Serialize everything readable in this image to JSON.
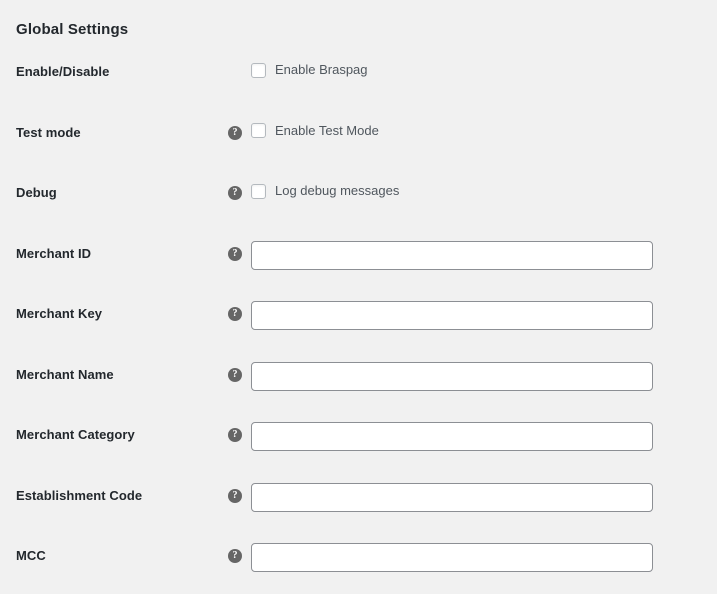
{
  "panel": {
    "heading": "Global Settings",
    "help_icon_glyph": "?",
    "help_icon_name": "help-tip-icon",
    "background_color": "#f1f1f1",
    "label_color": "#23282d",
    "help_icon_color": "#666666",
    "input_border_color": "#8c8f94",
    "checkbox_border_color": "#b4b9be"
  },
  "rows": [
    {
      "id": "enable-disable",
      "label": "Enable/Disable",
      "type": "checkbox",
      "has_help_tip": false,
      "checkbox_label": "Enable Braspag",
      "checked": false
    },
    {
      "id": "test-mode",
      "label": "Test mode",
      "type": "checkbox",
      "has_help_tip": true,
      "checkbox_label": "Enable Test Mode",
      "checked": false
    },
    {
      "id": "debug",
      "label": "Debug",
      "type": "checkbox",
      "has_help_tip": true,
      "checkbox_label": "Log debug messages",
      "checked": false
    },
    {
      "id": "merchant-id",
      "label": "Merchant ID",
      "type": "text",
      "has_help_tip": true,
      "value": "",
      "placeholder": ""
    },
    {
      "id": "merchant-key",
      "label": "Merchant Key",
      "type": "text",
      "has_help_tip": true,
      "value": "",
      "placeholder": ""
    },
    {
      "id": "merchant-name",
      "label": "Merchant Name",
      "type": "text",
      "has_help_tip": true,
      "value": "",
      "placeholder": ""
    },
    {
      "id": "merchant-category",
      "label": "Merchant Category",
      "type": "text",
      "has_help_tip": true,
      "value": "",
      "placeholder": ""
    },
    {
      "id": "establishment-code",
      "label": "Establishment Code",
      "type": "text",
      "has_help_tip": true,
      "value": "",
      "placeholder": ""
    },
    {
      "id": "mcc",
      "label": "MCC",
      "type": "text",
      "has_help_tip": true,
      "value": "",
      "placeholder": ""
    }
  ]
}
